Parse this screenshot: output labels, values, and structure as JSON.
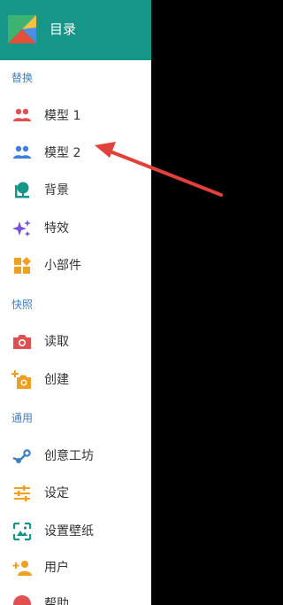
{
  "header": {
    "title": "目录",
    "background": "#159688"
  },
  "sections": {
    "replace": "替换",
    "snapshot": "快照",
    "general": "通用"
  },
  "items": {
    "model1": {
      "label": "模型 1",
      "icon": "people-icon",
      "color": "#e05050"
    },
    "model2": {
      "label": "模型 2",
      "icon": "people-icon",
      "color": "#3f7fe0"
    },
    "background": {
      "label": "背景",
      "icon": "tree-icon",
      "color": "#159688"
    },
    "effects": {
      "label": "特效",
      "icon": "sparkle-icon",
      "color": "#7b4fd9"
    },
    "widgets": {
      "label": "小部件",
      "icon": "widgets-icon",
      "color": "#f0a020"
    },
    "read": {
      "label": "读取",
      "icon": "camera-icon",
      "color": "#e05050"
    },
    "create": {
      "label": "创建",
      "icon": "add-camera-icon",
      "color": "#f0a020"
    },
    "workshop": {
      "label": "创意工坊",
      "icon": "steam-icon",
      "color": "#3f7fc0"
    },
    "settings": {
      "label": "设定",
      "icon": "tune-icon",
      "color": "#f0a020"
    },
    "wallpaper": {
      "label": "设置壁纸",
      "icon": "wallpaper-icon",
      "color": "#159688"
    },
    "user": {
      "label": "用户",
      "icon": "add-user-icon",
      "color": "#f0a020"
    },
    "help": {
      "label": "帮助",
      "icon": "help-icon",
      "color": "#e05050"
    }
  },
  "annotation": {
    "arrow_color": "#e0413a"
  }
}
